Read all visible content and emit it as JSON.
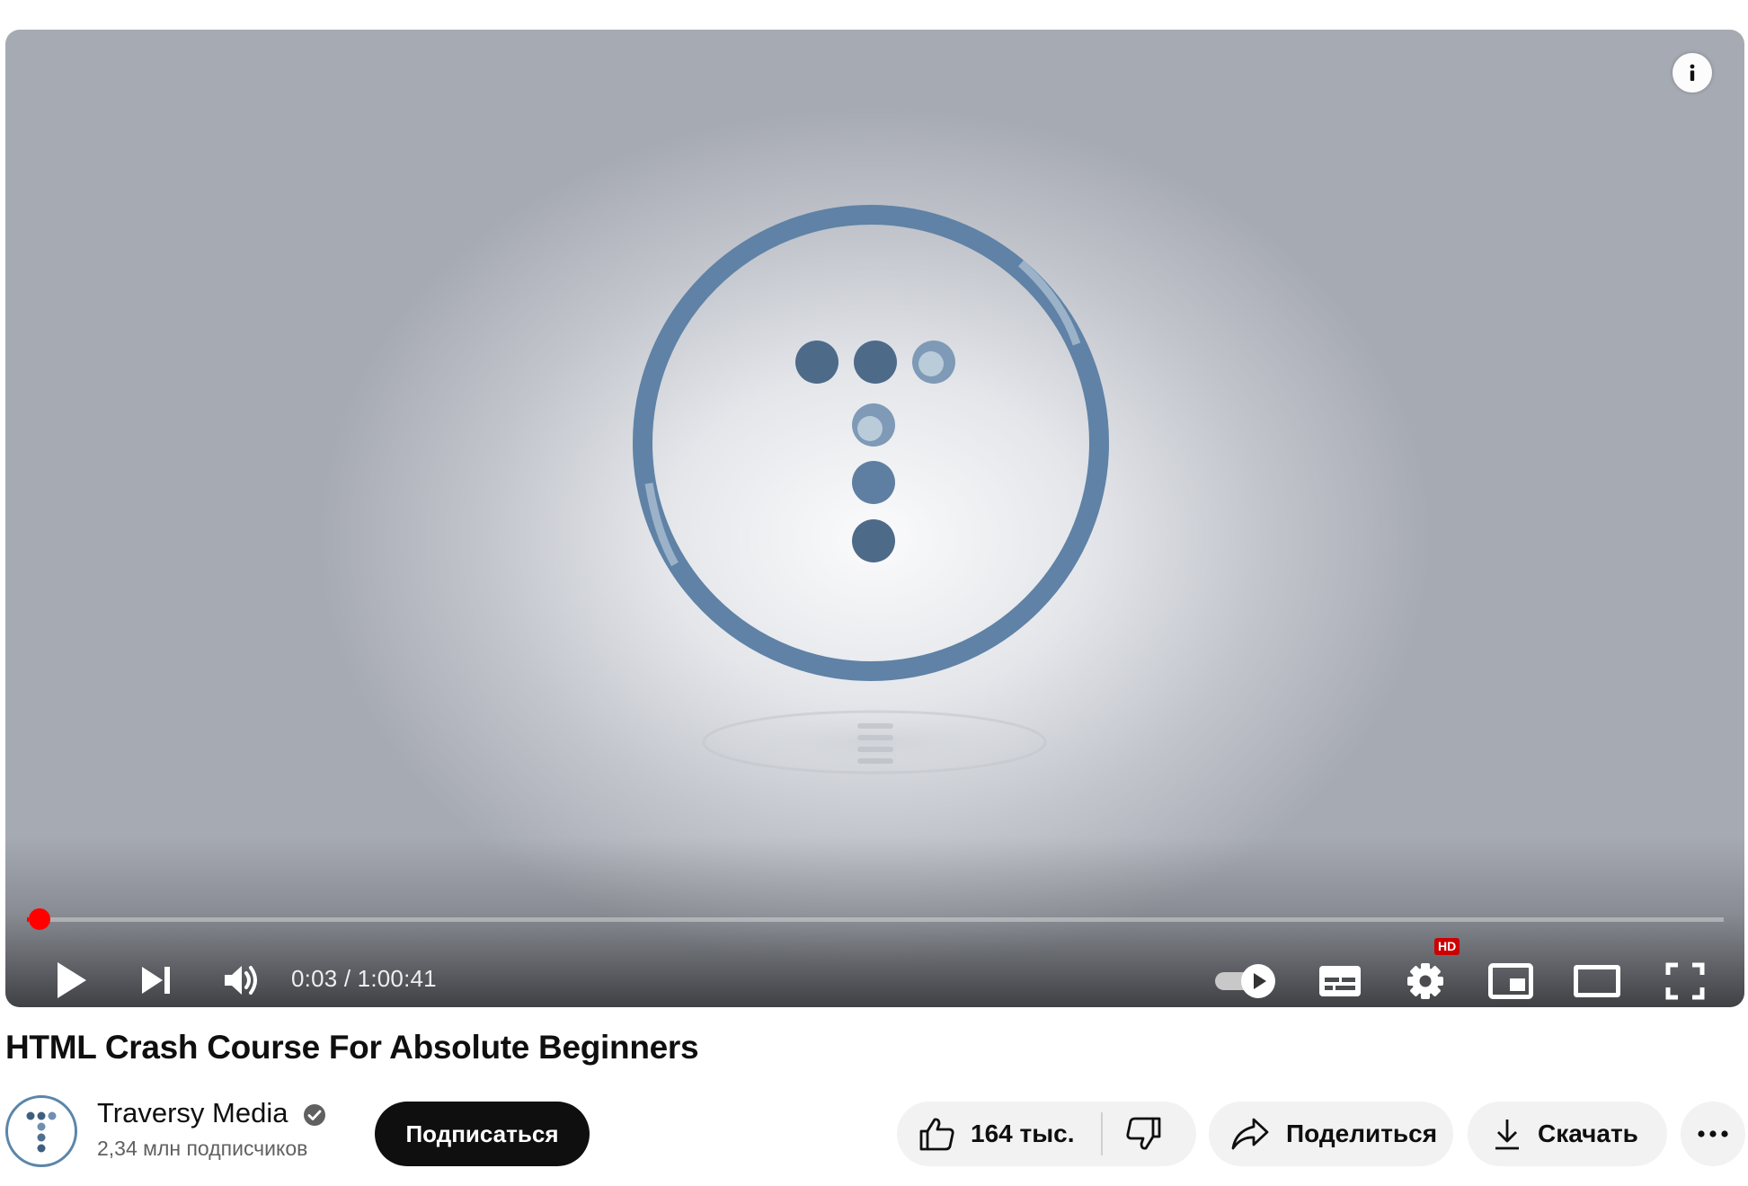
{
  "player": {
    "time_current": "0:03",
    "time_total": "1:00:41",
    "time_display": "0:03 / 1:00:41",
    "progress": 0.0008,
    "quality_badge": "HD",
    "accent_color": "#ff0000"
  },
  "icons": {
    "info": "info-icon",
    "play": "play-icon",
    "next": "next-icon",
    "volume": "volume-icon",
    "autoplay": "autoplay-toggle-icon",
    "subtitles": "subtitles-icon",
    "settings": "settings-gear-icon",
    "miniplayer": "miniplayer-icon",
    "theater": "theater-mode-icon",
    "fullscreen": "fullscreen-icon",
    "like": "thumbs-up-icon",
    "dislike": "thumbs-down-icon",
    "share": "share-arrow-icon",
    "download": "download-icon",
    "more": "more-horizontal-icon",
    "verified": "verified-check-icon"
  },
  "video": {
    "title": "HTML Crash Course For Absolute Beginners"
  },
  "channel": {
    "name": "Traversy Media",
    "subscribers": "2,34 млн подписчиков",
    "brand_color": "#5b86aa"
  },
  "actions": {
    "subscribe_label": "Подписаться",
    "like_count": "164 тыс.",
    "share_label": "Поделиться",
    "download_label": "Скачать"
  }
}
